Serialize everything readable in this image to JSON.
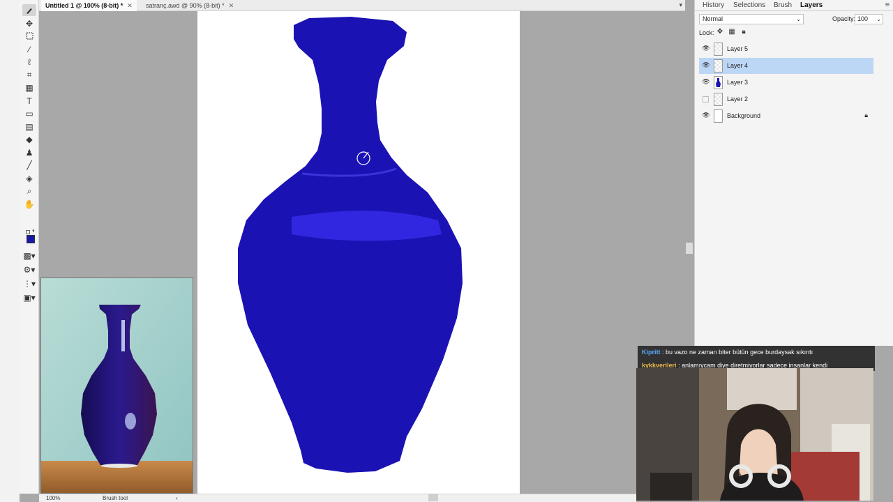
{
  "tabs": [
    {
      "label": "Untitled 1 @ 100% (8-bit) *",
      "active": true
    },
    {
      "label": "satranç.awd @ 90% (8-bit) *",
      "active": false
    }
  ],
  "tools": [
    "brush-icon",
    "move-icon",
    "rect-select-icon",
    "magic-wand-icon",
    "lasso-icon",
    "crop-icon",
    "grid-icon",
    "text-icon",
    "shape-icon",
    "gradient-icon",
    "eraser-icon",
    "stamp-icon",
    "eyedropper-icon",
    "fill-icon",
    "zoom-icon",
    "hand-icon"
  ],
  "colors": {
    "foreground": "#1a18a8",
    "accent_selected": "#bcd6f5",
    "vase": "#1b12b4",
    "vase_highlight": "#3a2ff0"
  },
  "panel": {
    "tabs": [
      "History",
      "Selections",
      "Brush",
      "Layers"
    ],
    "active_tab": "Layers",
    "blend_mode": "Normal",
    "opacity_label": "Opacity:",
    "opacity_value": "100",
    "lock_label": "Lock:",
    "layers": [
      {
        "name": "Layer 5",
        "visible": true,
        "selected": false
      },
      {
        "name": "Layer 4",
        "visible": true,
        "selected": true
      },
      {
        "name": "Layer 3",
        "visible": true,
        "selected": false
      },
      {
        "name": "Layer 2",
        "visible": false,
        "selected": false
      },
      {
        "name": "Background",
        "visible": true,
        "selected": false,
        "locked": true
      }
    ]
  },
  "status": {
    "zoom": "100%",
    "tool": "Brush tool"
  },
  "chat": [
    {
      "user": "Kipritt",
      "message": ": bu vazo ne zaman biter bütün gece burdaysak sıkıntı"
    },
    {
      "user": "kykkverileri",
      "message": ": anlamıycam diye diretmiyorlar sadece insanlar kendi"
    }
  ]
}
